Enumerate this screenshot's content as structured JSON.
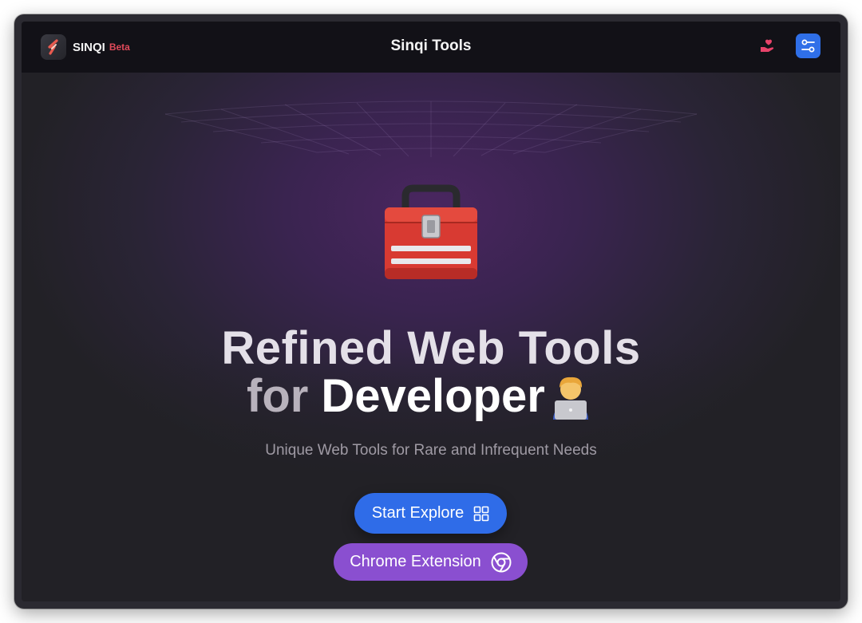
{
  "navbar": {
    "brand_name": "SINQI",
    "brand_badge": "Beta",
    "title": "Sinqi Tools",
    "donate_icon": "heart-hand-icon",
    "settings_icon": "sliders-icon"
  },
  "hero": {
    "illustration": "toolbox-emoji",
    "line1": "Refined Web Tools",
    "line2_prefix": "for",
    "line2_highlight": "Developer",
    "emoji": "technologist-emoji",
    "subtitle": "Unique Web Tools for Rare and Infrequent Needs"
  },
  "actions": {
    "explore_label": "Start Explore",
    "explore_icon": "grid-icon",
    "chrome_label": "Chrome Extension",
    "chrome_icon": "chrome-icon"
  },
  "colors": {
    "primary_button": "#2f6ce8",
    "extension_button": "#8a4fd0",
    "brand_accent": "#e04a5a",
    "navbar_bg": "#121117"
  }
}
